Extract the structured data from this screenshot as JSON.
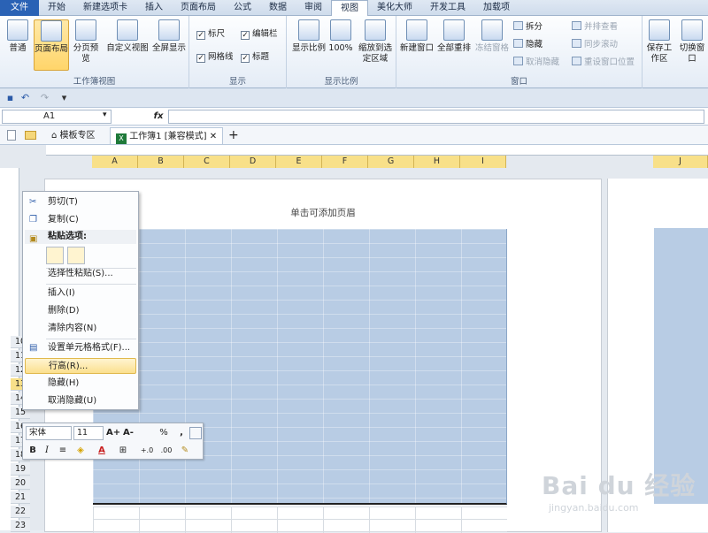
{
  "ribbon_tabs": [
    "文件",
    "开始",
    "新建选项卡",
    "插入",
    "页面布局",
    "公式",
    "数据",
    "审阅",
    "视图",
    "美化大师",
    "开发工具",
    "加载项"
  ],
  "active_tab": "视图",
  "groups": {
    "workbook_views": {
      "label": "工作簿视图",
      "buttons": [
        "普通",
        "页面布局",
        "分页预览",
        "自定义视图",
        "全屏显示"
      ]
    },
    "show": {
      "label": "显示",
      "checks": [
        {
          "label": "标尺",
          "checked": true
        },
        {
          "label": "编辑栏",
          "checked": true
        },
        {
          "label": "网格线",
          "checked": true
        },
        {
          "label": "标题",
          "checked": true
        }
      ]
    },
    "zoom": {
      "label": "显示比例",
      "buttons": [
        "显示比例",
        "100%",
        "缩放到选定区域"
      ]
    },
    "window": {
      "label": "窗口",
      "buttons": [
        "新建窗口",
        "全部重排",
        "冻结窗格"
      ],
      "small": [
        "拆分",
        "隐藏",
        "取消隐藏",
        "并排查看",
        "同步滚动",
        "重设窗口位置"
      ]
    },
    "right": {
      "buttons": [
        "保存工作区",
        "切换窗口"
      ]
    }
  },
  "qat": {
    "icons": [
      "save-icon",
      "undo-icon",
      "redo-icon",
      "customize-icon"
    ]
  },
  "formula_bar": {
    "name_box": "A1",
    "fx": "fx",
    "value": ""
  },
  "doc_tabs": {
    "template": "模板专区",
    "workbook": "工作簿1  [兼容模式]",
    "add": "+"
  },
  "columns": [
    "A",
    "B",
    "C",
    "D",
    "E",
    "F",
    "G",
    "H",
    "I",
    "J"
  ],
  "rows": [
    "1",
    "2",
    "3",
    "4",
    "5",
    "6",
    "7",
    "8",
    "9",
    "10",
    "11",
    "12",
    "13",
    "14",
    "15",
    "16",
    "17",
    "18",
    "19",
    "20",
    "21",
    "22",
    "23",
    "24"
  ],
  "selected_row": "13",
  "page": {
    "header_hint": "单击可添加页眉"
  },
  "context_menu": {
    "items": [
      {
        "label": "剪切(T)",
        "icon": "scissors-icon"
      },
      {
        "label": "复制(C)",
        "icon": "copy-icon"
      },
      {
        "label": "粘贴选项:",
        "icon": "paste-icon"
      },
      {
        "label": "选择性粘贴(S)..."
      },
      {
        "label": "插入(I)"
      },
      {
        "label": "删除(D)"
      },
      {
        "label": "清除内容(N)"
      },
      {
        "label": "设置单元格格式(F)...",
        "icon": "format-cells-icon"
      },
      {
        "label": "行高(R)..."
      },
      {
        "label": "隐藏(H)"
      },
      {
        "label": "取消隐藏(U)"
      }
    ],
    "highlighted": "行高(R)..."
  },
  "mini_toolbar": {
    "font": "宋体",
    "size": "11",
    "buttons_row1": [
      "A+",
      "A-",
      "%",
      ","
    ],
    "buttons_row2": [
      "B",
      "I",
      "align",
      "fill",
      "A",
      "border",
      "+.0",
      ".00"
    ]
  },
  "watermark": {
    "brand": "Bai du 经验",
    "url": "jingyan.baidu.com"
  }
}
